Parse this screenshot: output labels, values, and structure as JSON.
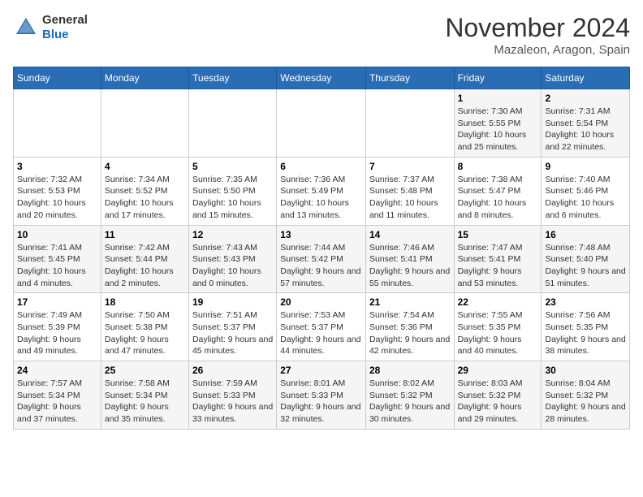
{
  "header": {
    "logo_general": "General",
    "logo_blue": "Blue",
    "month": "November 2024",
    "location": "Mazaleon, Aragon, Spain"
  },
  "weekdays": [
    "Sunday",
    "Monday",
    "Tuesday",
    "Wednesday",
    "Thursday",
    "Friday",
    "Saturday"
  ],
  "weeks": [
    [
      {
        "day": "",
        "info": ""
      },
      {
        "day": "",
        "info": ""
      },
      {
        "day": "",
        "info": ""
      },
      {
        "day": "",
        "info": ""
      },
      {
        "day": "",
        "info": ""
      },
      {
        "day": "1",
        "info": "Sunrise: 7:30 AM\nSunset: 5:55 PM\nDaylight: 10 hours and 25 minutes."
      },
      {
        "day": "2",
        "info": "Sunrise: 7:31 AM\nSunset: 5:54 PM\nDaylight: 10 hours and 22 minutes."
      }
    ],
    [
      {
        "day": "3",
        "info": "Sunrise: 7:32 AM\nSunset: 5:53 PM\nDaylight: 10 hours and 20 minutes."
      },
      {
        "day": "4",
        "info": "Sunrise: 7:34 AM\nSunset: 5:52 PM\nDaylight: 10 hours and 17 minutes."
      },
      {
        "day": "5",
        "info": "Sunrise: 7:35 AM\nSunset: 5:50 PM\nDaylight: 10 hours and 15 minutes."
      },
      {
        "day": "6",
        "info": "Sunrise: 7:36 AM\nSunset: 5:49 PM\nDaylight: 10 hours and 13 minutes."
      },
      {
        "day": "7",
        "info": "Sunrise: 7:37 AM\nSunset: 5:48 PM\nDaylight: 10 hours and 11 minutes."
      },
      {
        "day": "8",
        "info": "Sunrise: 7:38 AM\nSunset: 5:47 PM\nDaylight: 10 hours and 8 minutes."
      },
      {
        "day": "9",
        "info": "Sunrise: 7:40 AM\nSunset: 5:46 PM\nDaylight: 10 hours and 6 minutes."
      }
    ],
    [
      {
        "day": "10",
        "info": "Sunrise: 7:41 AM\nSunset: 5:45 PM\nDaylight: 10 hours and 4 minutes."
      },
      {
        "day": "11",
        "info": "Sunrise: 7:42 AM\nSunset: 5:44 PM\nDaylight: 10 hours and 2 minutes."
      },
      {
        "day": "12",
        "info": "Sunrise: 7:43 AM\nSunset: 5:43 PM\nDaylight: 10 hours and 0 minutes."
      },
      {
        "day": "13",
        "info": "Sunrise: 7:44 AM\nSunset: 5:42 PM\nDaylight: 9 hours and 57 minutes."
      },
      {
        "day": "14",
        "info": "Sunrise: 7:46 AM\nSunset: 5:41 PM\nDaylight: 9 hours and 55 minutes."
      },
      {
        "day": "15",
        "info": "Sunrise: 7:47 AM\nSunset: 5:41 PM\nDaylight: 9 hours and 53 minutes."
      },
      {
        "day": "16",
        "info": "Sunrise: 7:48 AM\nSunset: 5:40 PM\nDaylight: 9 hours and 51 minutes."
      }
    ],
    [
      {
        "day": "17",
        "info": "Sunrise: 7:49 AM\nSunset: 5:39 PM\nDaylight: 9 hours and 49 minutes."
      },
      {
        "day": "18",
        "info": "Sunrise: 7:50 AM\nSunset: 5:38 PM\nDaylight: 9 hours and 47 minutes."
      },
      {
        "day": "19",
        "info": "Sunrise: 7:51 AM\nSunset: 5:37 PM\nDaylight: 9 hours and 45 minutes."
      },
      {
        "day": "20",
        "info": "Sunrise: 7:53 AM\nSunset: 5:37 PM\nDaylight: 9 hours and 44 minutes."
      },
      {
        "day": "21",
        "info": "Sunrise: 7:54 AM\nSunset: 5:36 PM\nDaylight: 9 hours and 42 minutes."
      },
      {
        "day": "22",
        "info": "Sunrise: 7:55 AM\nSunset: 5:35 PM\nDaylight: 9 hours and 40 minutes."
      },
      {
        "day": "23",
        "info": "Sunrise: 7:56 AM\nSunset: 5:35 PM\nDaylight: 9 hours and 38 minutes."
      }
    ],
    [
      {
        "day": "24",
        "info": "Sunrise: 7:57 AM\nSunset: 5:34 PM\nDaylight: 9 hours and 37 minutes."
      },
      {
        "day": "25",
        "info": "Sunrise: 7:58 AM\nSunset: 5:34 PM\nDaylight: 9 hours and 35 minutes."
      },
      {
        "day": "26",
        "info": "Sunrise: 7:59 AM\nSunset: 5:33 PM\nDaylight: 9 hours and 33 minutes."
      },
      {
        "day": "27",
        "info": "Sunrise: 8:01 AM\nSunset: 5:33 PM\nDaylight: 9 hours and 32 minutes."
      },
      {
        "day": "28",
        "info": "Sunrise: 8:02 AM\nSunset: 5:32 PM\nDaylight: 9 hours and 30 minutes."
      },
      {
        "day": "29",
        "info": "Sunrise: 8:03 AM\nSunset: 5:32 PM\nDaylight: 9 hours and 29 minutes."
      },
      {
        "day": "30",
        "info": "Sunrise: 8:04 AM\nSunset: 5:32 PM\nDaylight: 9 hours and 28 minutes."
      }
    ]
  ]
}
